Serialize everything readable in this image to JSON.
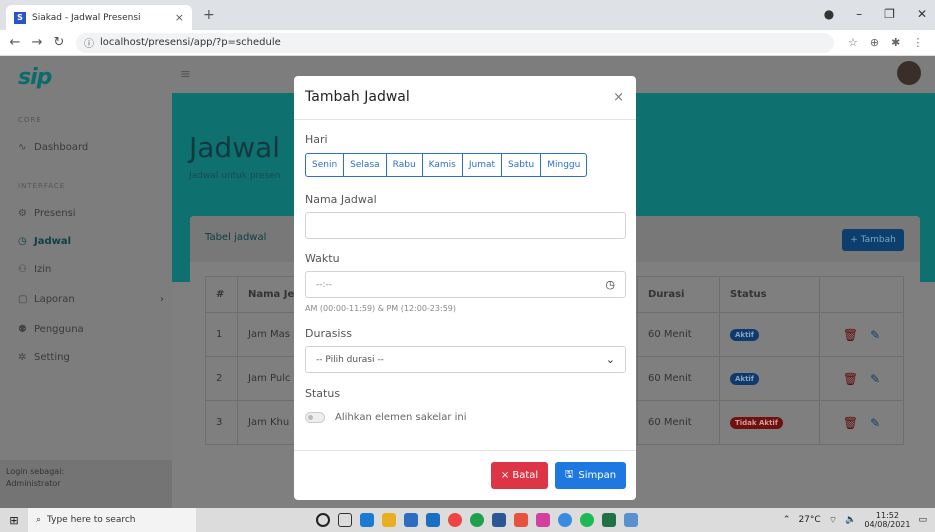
{
  "browser": {
    "tab_title": "Siakad - Jadwal Presensi",
    "tab_favicon": "S",
    "url": "localhost/presensi/app/?p=schedule"
  },
  "sidebar": {
    "brand": "sip",
    "section_core": "CORE",
    "section_interface": "INTERFACE",
    "items": [
      {
        "label": "Dashboard",
        "icon": "activity-icon"
      },
      {
        "label": "Presensi",
        "icon": "gear-icon"
      },
      {
        "label": "Jadwal",
        "icon": "clock-icon"
      },
      {
        "label": "Izin",
        "icon": "user-plus-icon"
      },
      {
        "label": "Laporan",
        "icon": "folder-icon"
      },
      {
        "label": "Pengguna",
        "icon": "users-icon"
      },
      {
        "label": "Setting",
        "icon": "settings-icon"
      }
    ],
    "login_label": "Login sebagai:",
    "login_role": "Administrator"
  },
  "page": {
    "title": "Jadwal",
    "subtitle": "Jadwal untuk presen",
    "card_title": "Tabel jadwal",
    "add_button": "+ Tambah"
  },
  "table": {
    "headers": [
      "#",
      "Nama Je",
      "Durasi",
      "Status"
    ],
    "rows": [
      {
        "no": "1",
        "name": "Jam Mas",
        "duration": "60 Menit",
        "status": "Aktif"
      },
      {
        "no": "2",
        "name": "Jam Pulc",
        "duration": "60 Menit",
        "status": "Aktif"
      },
      {
        "no": "3",
        "name": "Jam Khu",
        "duration": "60 Menit",
        "status": "Tidak Aktif"
      }
    ]
  },
  "modal": {
    "title": "Tambah Jadwal",
    "close": "×",
    "hari_label": "Hari",
    "days": [
      "Senin",
      "Selasa",
      "Rabu",
      "Kamis",
      "Jumat",
      "Sabtu",
      "Minggu"
    ],
    "nama_label": "Nama Jadwal",
    "nama_value": "",
    "waktu_label": "Waktu",
    "waktu_placeholder": "--:--",
    "waktu_hint": "AM (00:00-11:59) & PM (12:00-23:59)",
    "durasi_label": "Durasiss",
    "durasi_selected": "-- Pilih durasi --",
    "status_label": "Status",
    "toggle_label": "Alihkan elemen sakelar ini",
    "batal": "× Batal",
    "simpan": "Simpan"
  },
  "taskbar": {
    "search_placeholder": "Type here to search",
    "weather": "27°C",
    "time": "11:52",
    "date": "04/08/2021"
  },
  "colors": {
    "accent": "#1e78e0",
    "danger": "#dc3545",
    "teal": "#0f7070"
  }
}
